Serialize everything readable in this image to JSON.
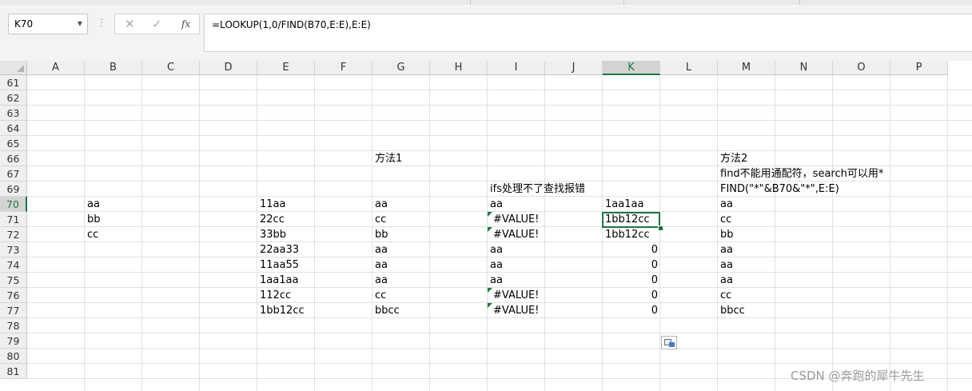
{
  "formula_bar": {
    "name_box": "K70",
    "cancel_icon": "✕",
    "enter_icon": "✓",
    "fx_label": "fx",
    "formula": "=LOOKUP(1,0/FIND(B70,E:E),E:E)"
  },
  "sheet": {
    "columns": [
      "A",
      "B",
      "C",
      "D",
      "E",
      "F",
      "G",
      "H",
      "I",
      "J",
      "K",
      "L",
      "M",
      "N",
      "O",
      "P"
    ],
    "active_column": "K",
    "rows": [
      "61",
      "62",
      "63",
      "64",
      "65",
      "66",
      "67",
      "69",
      "70",
      "71",
      "72",
      "73",
      "74",
      "75",
      "76",
      "77",
      "78",
      "79",
      "80",
      "81"
    ],
    "active_row": "70",
    "selected_cell": "K70",
    "cells": [
      {
        "row": "66",
        "col": "G",
        "text": "方法1"
      },
      {
        "row": "66",
        "col": "M",
        "text": "方法2"
      },
      {
        "row": "67",
        "col": "M",
        "text": "find不能用通配符，search可以用*"
      },
      {
        "row": "69",
        "col": "I",
        "text": "ifs处理不了查找报错"
      },
      {
        "row": "69",
        "col": "M",
        "text": "FIND(\"*\"&B70&\"*\",E:E)"
      },
      {
        "row": "70",
        "col": "B",
        "text": "aa"
      },
      {
        "row": "70",
        "col": "E",
        "text": "11aa"
      },
      {
        "row": "70",
        "col": "G",
        "text": "aa"
      },
      {
        "row": "70",
        "col": "I",
        "text": "aa"
      },
      {
        "row": "70",
        "col": "K",
        "text": "1aa1aa"
      },
      {
        "row": "70",
        "col": "M",
        "text": "aa"
      },
      {
        "row": "71",
        "col": "B",
        "text": "bb"
      },
      {
        "row": "71",
        "col": "E",
        "text": "22cc"
      },
      {
        "row": "71",
        "col": "G",
        "text": "cc"
      },
      {
        "row": "71",
        "col": "I",
        "text": "#VALUE!",
        "error": true
      },
      {
        "row": "71",
        "col": "K",
        "text": "1bb12cc"
      },
      {
        "row": "71",
        "col": "M",
        "text": "cc"
      },
      {
        "row": "72",
        "col": "B",
        "text": "cc"
      },
      {
        "row": "72",
        "col": "E",
        "text": "33bb"
      },
      {
        "row": "72",
        "col": "G",
        "text": "bb"
      },
      {
        "row": "72",
        "col": "I",
        "text": "#VALUE!",
        "error": true
      },
      {
        "row": "72",
        "col": "K",
        "text": "1bb12cc"
      },
      {
        "row": "72",
        "col": "M",
        "text": "bb"
      },
      {
        "row": "73",
        "col": "E",
        "text": "22aa33"
      },
      {
        "row": "73",
        "col": "G",
        "text": "aa"
      },
      {
        "row": "73",
        "col": "I",
        "text": "aa"
      },
      {
        "row": "73",
        "col": "K",
        "text": "0",
        "num": true
      },
      {
        "row": "73",
        "col": "M",
        "text": "aa"
      },
      {
        "row": "74",
        "col": "E",
        "text": "11aa55"
      },
      {
        "row": "74",
        "col": "G",
        "text": "aa"
      },
      {
        "row": "74",
        "col": "I",
        "text": "aa"
      },
      {
        "row": "74",
        "col": "K",
        "text": "0",
        "num": true
      },
      {
        "row": "74",
        "col": "M",
        "text": "aa"
      },
      {
        "row": "75",
        "col": "E",
        "text": "1aa1aa"
      },
      {
        "row": "75",
        "col": "G",
        "text": "aa"
      },
      {
        "row": "75",
        "col": "I",
        "text": "aa"
      },
      {
        "row": "75",
        "col": "K",
        "text": "0",
        "num": true
      },
      {
        "row": "75",
        "col": "M",
        "text": "aa"
      },
      {
        "row": "76",
        "col": "E",
        "text": "112cc"
      },
      {
        "row": "76",
        "col": "G",
        "text": "cc"
      },
      {
        "row": "76",
        "col": "I",
        "text": "#VALUE!",
        "error": true
      },
      {
        "row": "76",
        "col": "K",
        "text": "0",
        "num": true
      },
      {
        "row": "76",
        "col": "M",
        "text": "cc"
      },
      {
        "row": "77",
        "col": "E",
        "text": "1bb12cc"
      },
      {
        "row": "77",
        "col": "G",
        "text": "bbcc"
      },
      {
        "row": "77",
        "col": "I",
        "text": "#VALUE!",
        "error": true
      },
      {
        "row": "77",
        "col": "K",
        "text": "0",
        "num": true
      },
      {
        "row": "77",
        "col": "M",
        "text": "bbcc"
      }
    ]
  },
  "watermark": "CSDN @奔跑的犀牛先生",
  "colors": {
    "accent": "#217346",
    "error_marker": "#1e7b3c"
  },
  "icons": {
    "paste_options": "paste-options-icon",
    "name_box_dropdown": "chevron-down-icon"
  }
}
